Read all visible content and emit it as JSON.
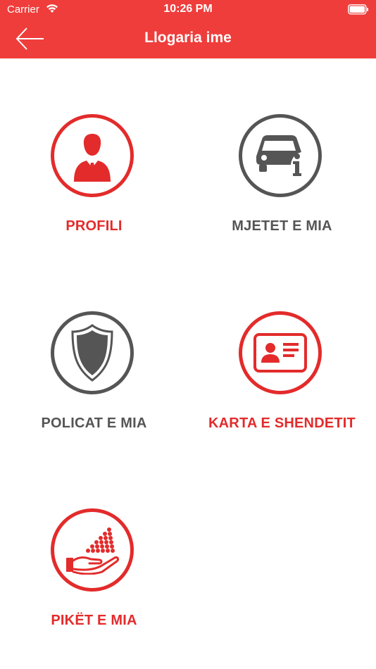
{
  "status_bar": {
    "carrier": "Carrier",
    "time": "10:26 PM",
    "wifi_icon": "wifi-icon",
    "battery_icon": "battery-icon"
  },
  "nav": {
    "title": "Llogaria ime",
    "back_icon": "arrow-left-icon"
  },
  "colors": {
    "header_bg": "#ef3d3b",
    "accent_red": "#e32b2b",
    "gray": "#555555"
  },
  "menu": [
    {
      "label": "PROFILI",
      "icon": "person-icon",
      "color": "red"
    },
    {
      "label": "MJETET E MIA",
      "icon": "car-info-icon",
      "color": "gray"
    },
    {
      "label": "POLICAT E MIA",
      "icon": "shield-icon",
      "color": "gray"
    },
    {
      "label": "KARTA E SHENDETIT",
      "icon": "id-card-icon",
      "color": "red"
    },
    {
      "label": "PIKËT E MIA",
      "icon": "hand-points-icon",
      "color": "red"
    }
  ]
}
